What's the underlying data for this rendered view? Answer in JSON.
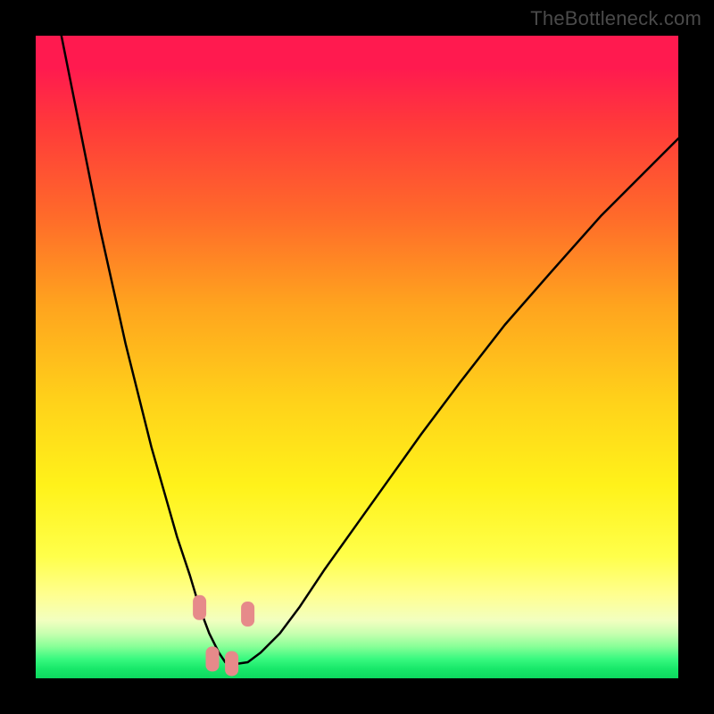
{
  "attribution": "TheBottleneck.com",
  "chart_data": {
    "type": "line",
    "title": "",
    "xlabel": "",
    "ylabel": "",
    "xlim": [
      0,
      100
    ],
    "ylim": [
      0,
      100
    ],
    "background_gradient": {
      "top_color": "#ff1a4f",
      "bottom_color": "#0dd85e",
      "meaning": "red = high bottleneck, green = no bottleneck"
    },
    "series": [
      {
        "name": "bottleneck-curve",
        "color": "#000000",
        "x": [
          4,
          6,
          8,
          10,
          12,
          14,
          16,
          18,
          20,
          22,
          24,
          25.5,
          27,
          28.5,
          29.5,
          31,
          33,
          35,
          38,
          41,
          45,
          50,
          55,
          60,
          66,
          73,
          80,
          88,
          96,
          100
        ],
        "y": [
          100,
          90,
          80,
          70,
          61,
          52,
          44,
          36,
          29,
          22,
          16,
          11,
          7,
          4,
          2.5,
          2.2,
          2.5,
          4,
          7,
          11,
          17,
          24,
          31,
          38,
          46,
          55,
          63,
          72,
          80,
          84
        ]
      }
    ],
    "markers": [
      {
        "name": "pink-marker-left",
        "x": 25.5,
        "y": 11,
        "color": "#e68a8a"
      },
      {
        "name": "pink-marker-bottom-1",
        "x": 27.5,
        "y": 3,
        "color": "#e68a8a"
      },
      {
        "name": "pink-marker-bottom-2",
        "x": 30.5,
        "y": 2.3,
        "color": "#e68a8a"
      },
      {
        "name": "pink-marker-right",
        "x": 33.0,
        "y": 10,
        "color": "#e68a8a"
      }
    ]
  }
}
